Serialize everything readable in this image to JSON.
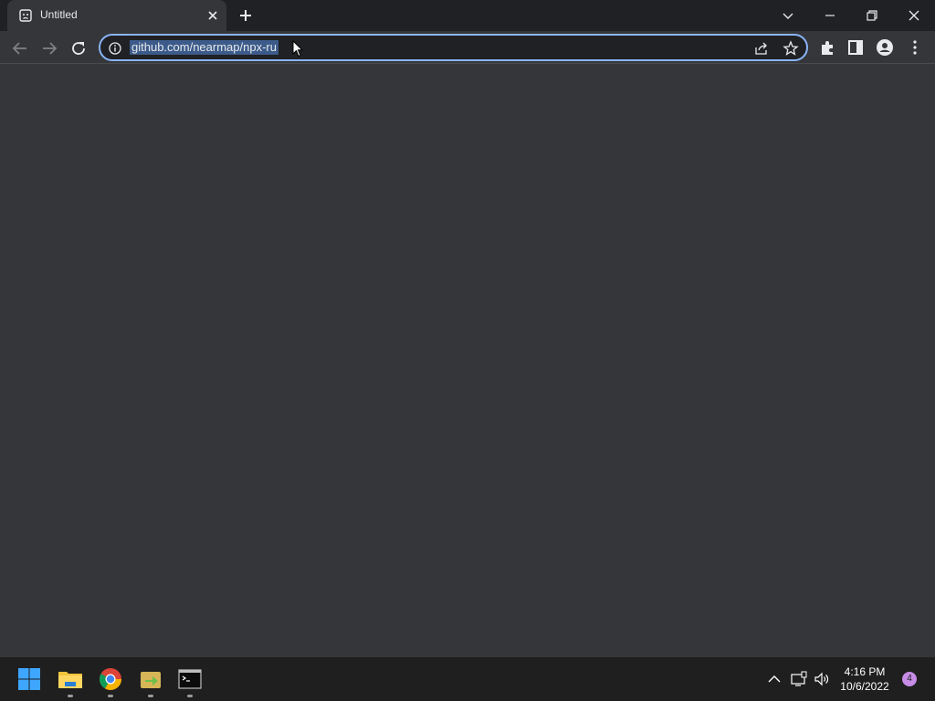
{
  "browser": {
    "tab": {
      "title": "Untitled",
      "favicon": "sad-face-page-icon"
    },
    "new_tab_icon": "plus-icon",
    "window_controls": [
      "tab-search-icon",
      "minimize-icon",
      "restore-icon",
      "close-icon"
    ],
    "address_bar": {
      "url": "github.com/nearmap/npx-ru",
      "selected": true
    },
    "toolbar_icons": [
      "back-icon",
      "forward-icon",
      "reload-icon",
      "info-icon",
      "share-icon",
      "star-icon",
      "extensions-icon",
      "side-panel-icon",
      "profile-icon",
      "menu-icon"
    ]
  },
  "taskbar": {
    "apps": [
      "windows-start-icon",
      "file-explorer-icon",
      "chrome-icon",
      "app-icon",
      "terminal-icon"
    ],
    "tray_icons": [
      "chevron-up-icon",
      "network-icon",
      "volume-icon"
    ],
    "clock": {
      "time": "4:16 PM",
      "date": "10/6/2022"
    },
    "notification_count": "4"
  },
  "colors": {
    "accent": "#8ab4f8",
    "background": "#35363a",
    "titlebar": "#202124",
    "taskbar": "#1f1f1f"
  }
}
